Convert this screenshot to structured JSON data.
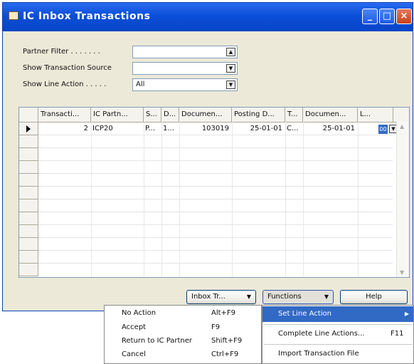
{
  "window": {
    "title": "IC Inbox Transactions",
    "controls": {
      "minimize": "_",
      "maximize": "□",
      "close": "×"
    }
  },
  "filters": {
    "partner_filter": {
      "label": "Partner Filter . . . . . . .",
      "value": ""
    },
    "transaction_source": {
      "label": "Show Transaction Source",
      "value": ""
    },
    "line_action": {
      "label": "Show Line Action . . . . .",
      "value": "All"
    }
  },
  "table": {
    "columns": [
      "Transacti...",
      "IC Partn...",
      "S...",
      "D...",
      "Documen...",
      "Posting D...",
      "T...",
      "Documen...",
      "L..."
    ],
    "rows": [
      {
        "transaction_no": "2",
        "ic_partner": "ICP20",
        "source": "P...",
        "doc_type": "1...",
        "document_no": "103019",
        "posting_date": "25-01-01",
        "transaction_type": "C...",
        "document_date": "25-01-01",
        "line_action": "00"
      }
    ]
  },
  "buttons": {
    "inbox_transaction": "Inbox Tr...",
    "functions": "Functions",
    "help": "Help"
  },
  "context_menu": {
    "items": [
      {
        "label": "No Action",
        "shortcut": "Alt+F9"
      },
      {
        "label": "Accept",
        "shortcut": "F9"
      },
      {
        "label": "Return to IC Partner",
        "shortcut": "Shift+F9"
      },
      {
        "label": "Cancel",
        "shortcut": "Ctrl+F9"
      }
    ]
  },
  "functions_menu": {
    "items": [
      {
        "label": "Set Line Action",
        "highlighted": true,
        "submenu": true
      },
      {
        "label": "Complete Line Actions...",
        "shortcut": "F11"
      },
      {
        "label": "Import Transaction File"
      }
    ]
  },
  "colors": {
    "title_bar": "#0a4fd8",
    "highlight": "#316ac5",
    "window_bg": "#ece9d8"
  },
  "icons": [
    "window-icon",
    "lookup-icon",
    "dropdown-icon",
    "row-pointer-icon",
    "submenu-arrow-icon"
  ]
}
